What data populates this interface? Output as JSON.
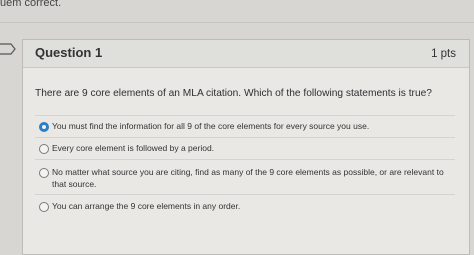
{
  "top_fragment": "uem correct.",
  "question": {
    "title": "Question 1",
    "points": "1 pts",
    "text": "There are 9 core elements of an MLA citation.  Which of the following statements is true?"
  },
  "options": [
    {
      "label": "You must find the information for all 9 of the core elements for every source you use.",
      "selected": true
    },
    {
      "label": "Every core element is followed by a period.",
      "selected": false
    },
    {
      "label": "No matter what source you are citing, find as many of the 9 core elements as possible, or are relevant to that source.",
      "selected": false
    },
    {
      "label": "You can arrange the 9 core elements in any order.",
      "selected": false
    }
  ],
  "colors": {
    "selected_radio": "#2b7ec8"
  },
  "icons": {
    "bookmark": "bookmark-icon"
  }
}
